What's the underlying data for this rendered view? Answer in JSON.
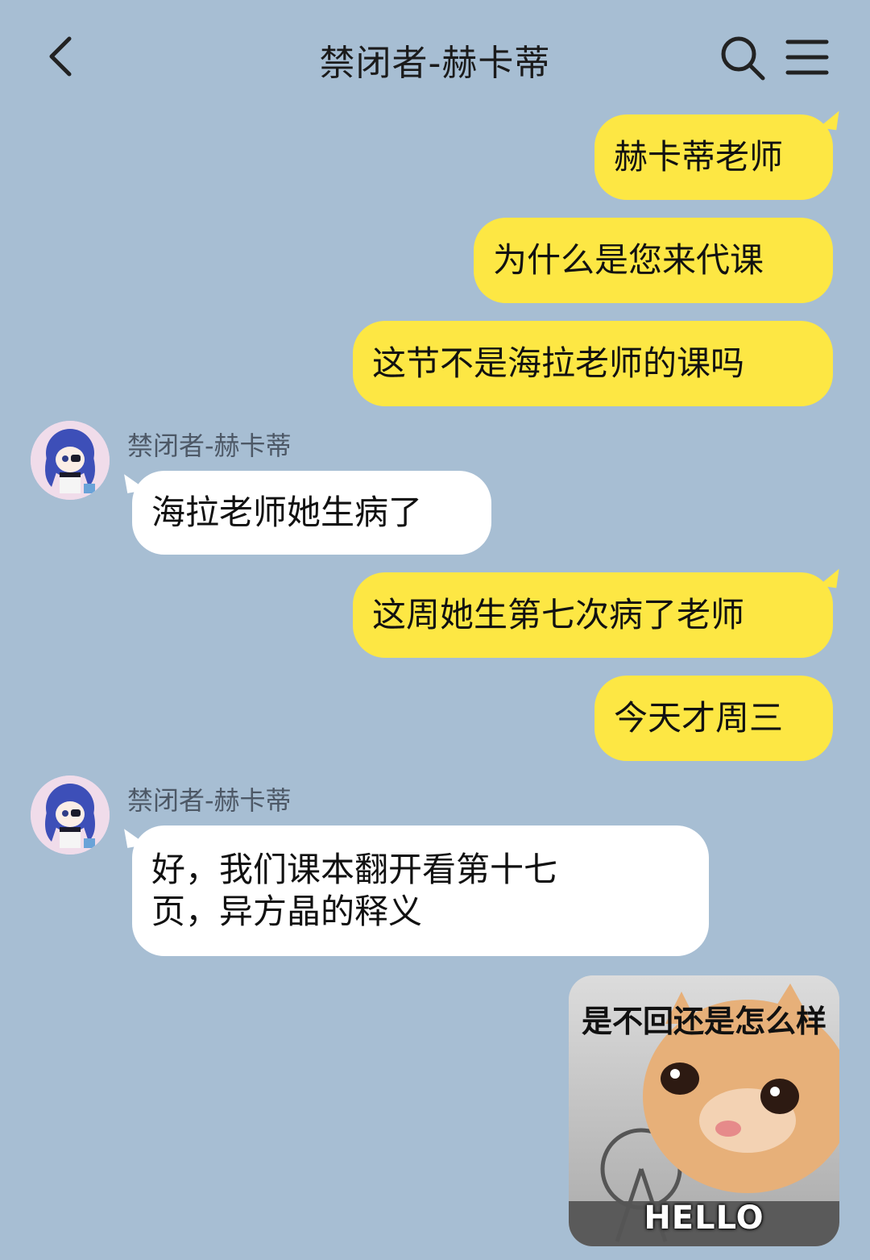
{
  "header": {
    "title": "禁闭者-赫卡蒂"
  },
  "sender_name": "禁闭者-赫卡蒂",
  "messages": [
    {
      "text": "赫卡蒂老师"
    },
    {
      "text": "为什么是您来代课"
    },
    {
      "text": "这节不是海拉老师的课吗"
    },
    {
      "text": "海拉老师她生病了"
    },
    {
      "text": "这周她生第七次病了老师"
    },
    {
      "text": "今天才周三"
    },
    {
      "line1": "好，我们课本翻开看第十七",
      "line2": "页，异方晶的释义"
    }
  ],
  "sticker": {
    "caption": "是不回还是怎么样",
    "bottom_text": "HELLO"
  },
  "colors": {
    "background": "#a7bed3",
    "outgoing_bubble": "#fde744",
    "incoming_bubble": "#ffffff"
  },
  "icons": {
    "back": "chevron-left-icon",
    "search": "search-icon",
    "menu": "menu-icon"
  }
}
